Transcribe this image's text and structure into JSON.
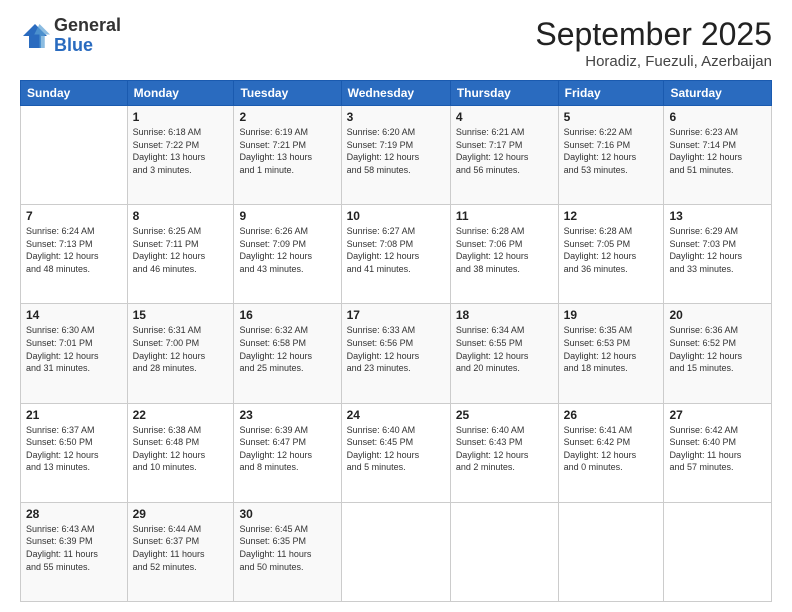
{
  "logo": {
    "general": "General",
    "blue": "Blue"
  },
  "title": "September 2025",
  "location": "Horadiz, Fuezuli, Azerbaijan",
  "days_of_week": [
    "Sunday",
    "Monday",
    "Tuesday",
    "Wednesday",
    "Thursday",
    "Friday",
    "Saturday"
  ],
  "weeks": [
    [
      {
        "day": "",
        "info": ""
      },
      {
        "day": "1",
        "info": "Sunrise: 6:18 AM\nSunset: 7:22 PM\nDaylight: 13 hours\nand 3 minutes."
      },
      {
        "day": "2",
        "info": "Sunrise: 6:19 AM\nSunset: 7:21 PM\nDaylight: 13 hours\nand 1 minute."
      },
      {
        "day": "3",
        "info": "Sunrise: 6:20 AM\nSunset: 7:19 PM\nDaylight: 12 hours\nand 58 minutes."
      },
      {
        "day": "4",
        "info": "Sunrise: 6:21 AM\nSunset: 7:17 PM\nDaylight: 12 hours\nand 56 minutes."
      },
      {
        "day": "5",
        "info": "Sunrise: 6:22 AM\nSunset: 7:16 PM\nDaylight: 12 hours\nand 53 minutes."
      },
      {
        "day": "6",
        "info": "Sunrise: 6:23 AM\nSunset: 7:14 PM\nDaylight: 12 hours\nand 51 minutes."
      }
    ],
    [
      {
        "day": "7",
        "info": "Sunrise: 6:24 AM\nSunset: 7:13 PM\nDaylight: 12 hours\nand 48 minutes."
      },
      {
        "day": "8",
        "info": "Sunrise: 6:25 AM\nSunset: 7:11 PM\nDaylight: 12 hours\nand 46 minutes."
      },
      {
        "day": "9",
        "info": "Sunrise: 6:26 AM\nSunset: 7:09 PM\nDaylight: 12 hours\nand 43 minutes."
      },
      {
        "day": "10",
        "info": "Sunrise: 6:27 AM\nSunset: 7:08 PM\nDaylight: 12 hours\nand 41 minutes."
      },
      {
        "day": "11",
        "info": "Sunrise: 6:28 AM\nSunset: 7:06 PM\nDaylight: 12 hours\nand 38 minutes."
      },
      {
        "day": "12",
        "info": "Sunrise: 6:28 AM\nSunset: 7:05 PM\nDaylight: 12 hours\nand 36 minutes."
      },
      {
        "day": "13",
        "info": "Sunrise: 6:29 AM\nSunset: 7:03 PM\nDaylight: 12 hours\nand 33 minutes."
      }
    ],
    [
      {
        "day": "14",
        "info": "Sunrise: 6:30 AM\nSunset: 7:01 PM\nDaylight: 12 hours\nand 31 minutes."
      },
      {
        "day": "15",
        "info": "Sunrise: 6:31 AM\nSunset: 7:00 PM\nDaylight: 12 hours\nand 28 minutes."
      },
      {
        "day": "16",
        "info": "Sunrise: 6:32 AM\nSunset: 6:58 PM\nDaylight: 12 hours\nand 25 minutes."
      },
      {
        "day": "17",
        "info": "Sunrise: 6:33 AM\nSunset: 6:56 PM\nDaylight: 12 hours\nand 23 minutes."
      },
      {
        "day": "18",
        "info": "Sunrise: 6:34 AM\nSunset: 6:55 PM\nDaylight: 12 hours\nand 20 minutes."
      },
      {
        "day": "19",
        "info": "Sunrise: 6:35 AM\nSunset: 6:53 PM\nDaylight: 12 hours\nand 18 minutes."
      },
      {
        "day": "20",
        "info": "Sunrise: 6:36 AM\nSunset: 6:52 PM\nDaylight: 12 hours\nand 15 minutes."
      }
    ],
    [
      {
        "day": "21",
        "info": "Sunrise: 6:37 AM\nSunset: 6:50 PM\nDaylight: 12 hours\nand 13 minutes."
      },
      {
        "day": "22",
        "info": "Sunrise: 6:38 AM\nSunset: 6:48 PM\nDaylight: 12 hours\nand 10 minutes."
      },
      {
        "day": "23",
        "info": "Sunrise: 6:39 AM\nSunset: 6:47 PM\nDaylight: 12 hours\nand 8 minutes."
      },
      {
        "day": "24",
        "info": "Sunrise: 6:40 AM\nSunset: 6:45 PM\nDaylight: 12 hours\nand 5 minutes."
      },
      {
        "day": "25",
        "info": "Sunrise: 6:40 AM\nSunset: 6:43 PM\nDaylight: 12 hours\nand 2 minutes."
      },
      {
        "day": "26",
        "info": "Sunrise: 6:41 AM\nSunset: 6:42 PM\nDaylight: 12 hours\nand 0 minutes."
      },
      {
        "day": "27",
        "info": "Sunrise: 6:42 AM\nSunset: 6:40 PM\nDaylight: 11 hours\nand 57 minutes."
      }
    ],
    [
      {
        "day": "28",
        "info": "Sunrise: 6:43 AM\nSunset: 6:39 PM\nDaylight: 11 hours\nand 55 minutes."
      },
      {
        "day": "29",
        "info": "Sunrise: 6:44 AM\nSunset: 6:37 PM\nDaylight: 11 hours\nand 52 minutes."
      },
      {
        "day": "30",
        "info": "Sunrise: 6:45 AM\nSunset: 6:35 PM\nDaylight: 11 hours\nand 50 minutes."
      },
      {
        "day": "",
        "info": ""
      },
      {
        "day": "",
        "info": ""
      },
      {
        "day": "",
        "info": ""
      },
      {
        "day": "",
        "info": ""
      }
    ]
  ]
}
